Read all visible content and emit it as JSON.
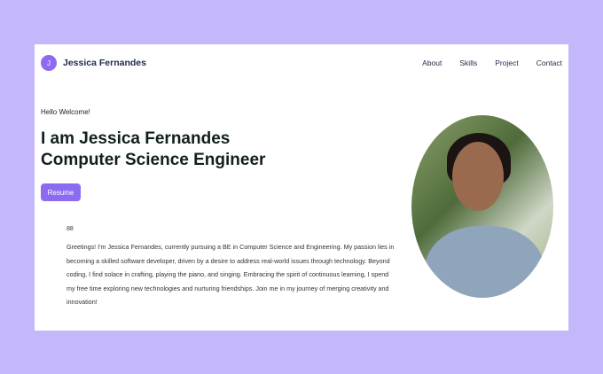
{
  "brand": {
    "initial": "J",
    "name": "Jessica Fernandes"
  },
  "nav": [
    "About",
    "Skills",
    "Project",
    "Contact"
  ],
  "hero": {
    "greeting": "Hello Welcome!",
    "title_line1": "I am Jessica Fernandes",
    "title_line2": "Computer Science Engineer",
    "resume_label": "Resume"
  },
  "bio": {
    "icon": "88",
    "text": "Greetings! I'm Jessica Fernandes, currently pursuing a BE in Computer Science and Engineering. My passion lies in becoming a skilled software developer, driven by a desire to address real-world issues through technology. Beyond coding, I find solace in crafting, playing the piano, and singing. Embracing the spirit of continuous learning, I spend my free time exploring new technologies and nurturing friendships. Join me in my journey of merging creativity and innovation!"
  },
  "colors": {
    "accent": "#8b6cf0",
    "background": "#c4b8fb"
  }
}
